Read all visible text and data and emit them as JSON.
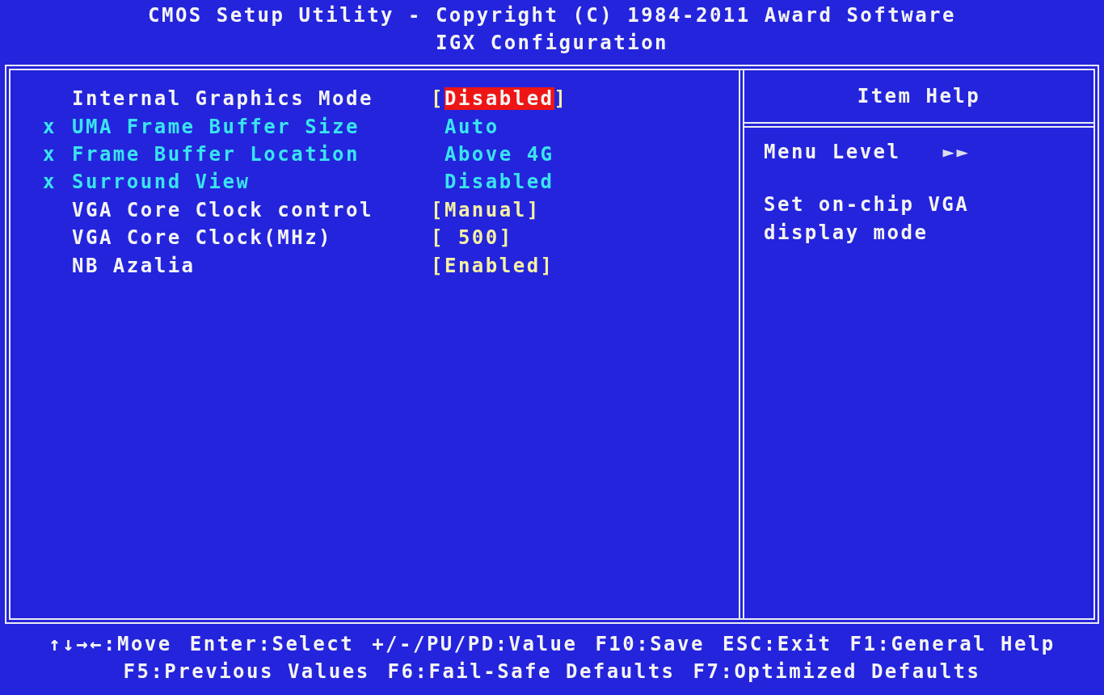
{
  "header": {
    "title": "CMOS Setup Utility - Copyright (C) 1984-2011 Award Software",
    "subtitle": "IGX Configuration"
  },
  "items": [
    {
      "label": "Internal Graphics Mode",
      "open": "[",
      "value": "Disabled",
      "close": "]",
      "disabled": false,
      "selected": true
    },
    {
      "mark": "x",
      "label": "UMA Frame Buffer Size",
      "value": "Auto",
      "disabled": true,
      "selected": false
    },
    {
      "mark": "x",
      "label": "Frame Buffer Location",
      "value": "Above 4G",
      "disabled": true,
      "selected": false
    },
    {
      "mark": "x",
      "label": "Surround View",
      "value": "Disabled",
      "disabled": true,
      "selected": false
    },
    {
      "label": "VGA Core Clock control",
      "open": "[",
      "value": "Manual",
      "close": "]",
      "disabled": false,
      "selected": false
    },
    {
      "label": "VGA Core Clock(MHz)",
      "open": "[",
      "value": " 500",
      "close": "]",
      "disabled": false,
      "selected": false
    },
    {
      "label": "NB Azalia",
      "open": "[",
      "value": "Enabled",
      "close": "]",
      "disabled": false,
      "selected": false
    }
  ],
  "help": {
    "title": "Item Help",
    "menu_level": "Menu Level",
    "menu_level_arrows": "►►",
    "text": "Set on-chip VGA display mode"
  },
  "footer": [
    [
      "↑↓→←:Move",
      "Enter:Select",
      "+/-/PU/PD:Value",
      "F10:Save",
      "ESC:Exit",
      "F1:General Help"
    ],
    [
      "F5:Previous Values",
      "F6:Fail-Safe Defaults",
      "F7:Optimized Defaults"
    ]
  ]
}
